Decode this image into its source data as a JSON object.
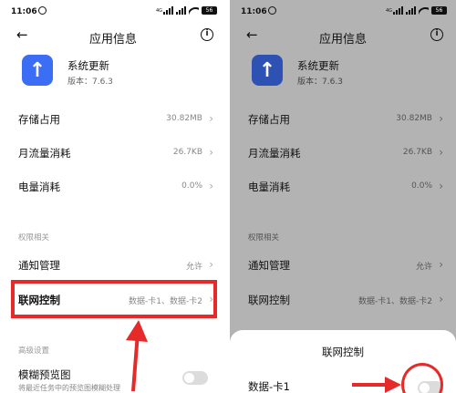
{
  "status_bar": {
    "time": "11:06",
    "net_label": "4G",
    "battery": "56"
  },
  "header": {
    "title": "应用信息"
  },
  "app": {
    "name": "系统更新",
    "version": "版本：7.6.3"
  },
  "rows": [
    {
      "label": "存储占用",
      "value": "30.82MB"
    },
    {
      "label": "月流量消耗",
      "value": "26.7KB"
    },
    {
      "label": "电量消耗",
      "value": "0.0%"
    }
  ],
  "permissions_section": "权限相关",
  "permission_rows": [
    {
      "label": "通知管理",
      "value": "允许"
    },
    {
      "label": "联网控制",
      "value": "数据-卡1、数据-卡2"
    }
  ],
  "advanced_section": "高级设置",
  "blur_preview": {
    "label": "模糊预览图",
    "sub": "将最近任务中的预览图模糊处理"
  },
  "sheet": {
    "title": "联网控制",
    "item": "数据-卡1"
  },
  "colors": {
    "accent": "#3b6ef5",
    "annotation": "#e62a2a",
    "dim_overlay": "#b3b3b3"
  }
}
